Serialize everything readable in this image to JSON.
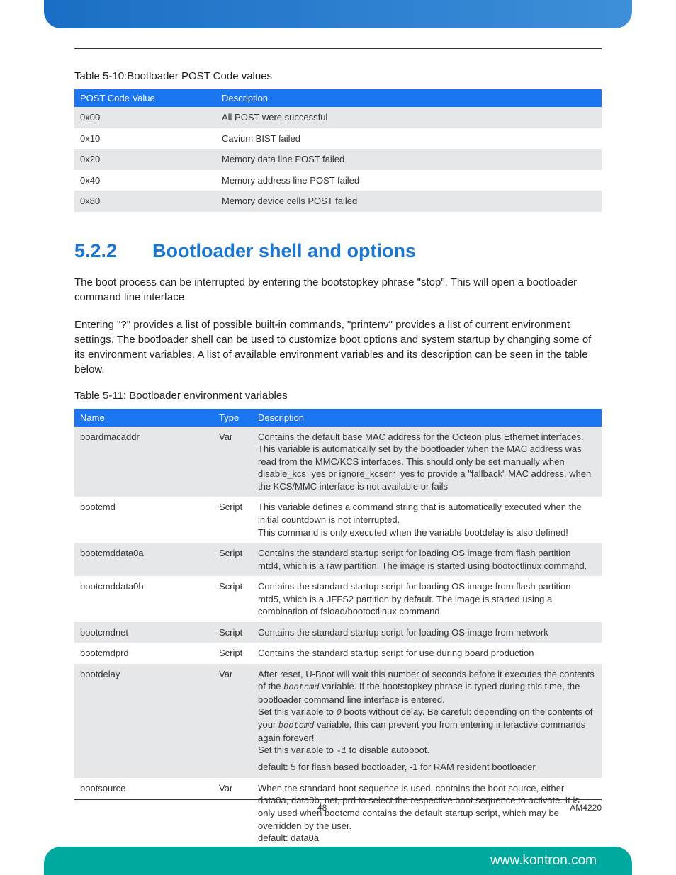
{
  "captions": {
    "table1": "Table 5-10:Bootloader POST Code values",
    "table2": "Table 5-11: Bootloader environment variables"
  },
  "table1": {
    "headers": [
      "POST Code Value",
      "Description"
    ],
    "rows": [
      [
        "0x00",
        "All POST were successful"
      ],
      [
        "0x10",
        "Cavium BIST failed"
      ],
      [
        "0x20",
        "Memory data line POST failed"
      ],
      [
        "0x40",
        "Memory address line POST failed"
      ],
      [
        "0x80",
        "Memory device cells POST failed"
      ]
    ]
  },
  "heading": {
    "num": "5.2.2",
    "title": "Bootloader shell and options"
  },
  "paragraphs": {
    "p1": "The boot process can be interrupted by entering the bootstopkey phrase \"stop\". This will open a bootloader command line interface.",
    "p2": "Entering \"?\" provides a list of possible built-in commands, \"printenv\" provides a list of current environment settings. The bootloader shell can be used to customize boot options and system startup by changing some of its environment variables. A list of available environment variables and its description can be seen in the table below."
  },
  "table2": {
    "headers": [
      "Name",
      "Type",
      "Description"
    ],
    "rows": [
      {
        "name": "boardmacaddr",
        "type": "Var",
        "desc": "Contains the default base MAC address for the Octeon plus Ethernet interfaces. This variable is automatically set by the bootloader when the MAC address was read from the MMC/KCS interfaces. This should only be set manually when disable_kcs=yes or ignore_kcserr=yes to provide a \"fallback\" MAC address, when the KCS/MMC interface is not available or fails"
      },
      {
        "name": "bootcmd",
        "type": "Script",
        "desc": "This variable defines a command string that is automatically executed when the initial countdown is not interrupted.\nThis command is only executed when the variable bootdelay is also defined!"
      },
      {
        "name": "bootcmddata0a",
        "type": "Script",
        "desc": "Contains the standard startup script for loading OS image from flash partition mtd4, which is a raw partition. The image is started using bootoctlinux command."
      },
      {
        "name": "bootcmddata0b",
        "type": "Script",
        "desc": "Contains the standard startup script for loading OS image from flash partition mtd5, which is a JFFS2 partition by default. The image is started using a combination of fsload/bootoctlinux command."
      },
      {
        "name": "bootcmdnet",
        "type": "Script",
        "desc": "Contains the standard startup script for loading OS image from network"
      },
      {
        "name": "bootcmdprd",
        "type": "Script",
        "desc": "Contains the standard startup script for use during board production"
      },
      {
        "name": "bootdelay",
        "type": "Var",
        "desc_html": "<span class='arial'>After reset, U-Boot will wait this number of seconds before it executes the contents of the <span class='italic'>bootcmd</span> variable. If the bootstopkey phrase is typed during this time, the bootloader command line interface is entered.<br>Set this variable to <span class='italic'>0</span> boots without delay. Be careful: depending on the contents of your <span class='italic'>bootcmd</span> variable, this can prevent you from entering interactive commands again forever!<br>Set this variable to <span class='italic'>-1</span> to disable autoboot.</span><div style='margin-top:6px'>default: 5 for flash based bootloader, -1 for RAM resident bootloader</div>"
      },
      {
        "name": "bootsource",
        "type": "Var",
        "desc": "When the standard boot sequence is used, contains the boot source, either data0a, data0b, net, prd to select the respective boot sequence to activate. It is only used when bootcmd contains the default startup script, which may be overridden by the user.\ndefault: data0a"
      }
    ]
  },
  "footer": {
    "page": "48",
    "doc": "AM4220"
  },
  "website": "www.kontron.com"
}
